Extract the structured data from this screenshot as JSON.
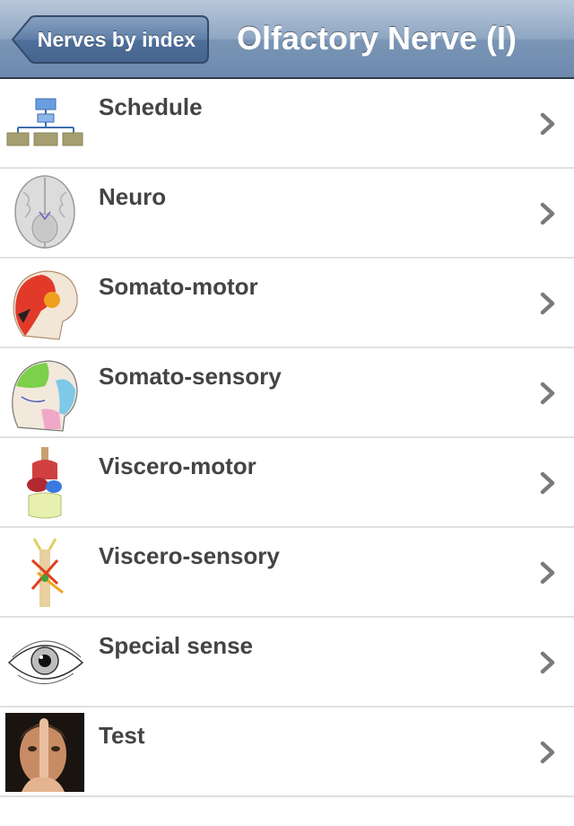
{
  "navbar": {
    "back_label": "Nerves by index",
    "title": "Olfactory Nerve (I)"
  },
  "rows": [
    {
      "label": "Schedule",
      "icon": "flowchart-icon"
    },
    {
      "label": "Neuro",
      "icon": "brain-icon"
    },
    {
      "label": "Somato-motor",
      "icon": "head-muscles-icon"
    },
    {
      "label": "Somato-sensory",
      "icon": "head-sensory-map-icon"
    },
    {
      "label": "Viscero-motor",
      "icon": "viscera-icon"
    },
    {
      "label": "Viscero-sensory",
      "icon": "viscero-sensory-icon"
    },
    {
      "label": "Special sense",
      "icon": "eye-icon"
    },
    {
      "label": "Test",
      "icon": "test-photo-icon"
    }
  ],
  "colors": {
    "navbar": "#7a95b5",
    "label_text": "#444444",
    "separator": "#e0e0e0",
    "chevron": "#7a7a7a"
  }
}
